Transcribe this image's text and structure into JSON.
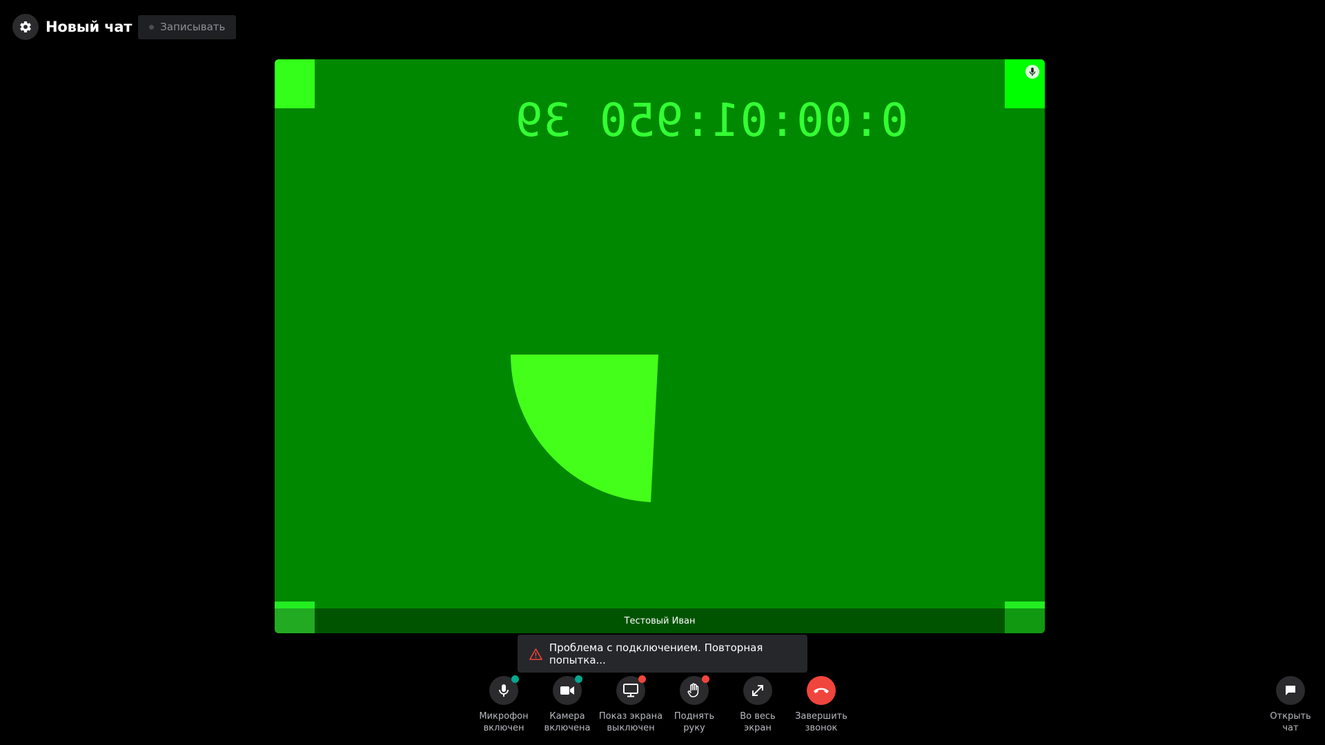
{
  "header": {
    "title": "Новый чат",
    "record_label": "Записывать"
  },
  "video": {
    "timecode": "0:00:01:950 39",
    "participant_name": "Тестовый Иван",
    "background_color": "#008800",
    "shape_color": "#44ff1a"
  },
  "toast": {
    "message": "Проблема с подключением. Повторная попытка..."
  },
  "controls": [
    {
      "id": "mic",
      "line1": "Микрофон",
      "line2": "включен",
      "dot": "#00a88f",
      "icon": "microphone-icon"
    },
    {
      "id": "camera",
      "line1": "Камера",
      "line2": "включена",
      "dot": "#00a88f",
      "icon": "camera-icon"
    },
    {
      "id": "screen",
      "line1": "Показ экрана",
      "line2": "выключен",
      "dot": "#f0453c",
      "icon": "monitor-icon"
    },
    {
      "id": "hand",
      "line1": "Поднять",
      "line2": "руку",
      "dot": "#f0453c",
      "icon": "hand-icon"
    },
    {
      "id": "fullscreen",
      "line1": "Во весь",
      "line2": "экран",
      "dot": null,
      "icon": "expand-icon"
    },
    {
      "id": "end",
      "line1": "Завершить",
      "line2": "звонок",
      "dot": null,
      "icon": "hang-up-icon"
    }
  ],
  "chat_toggle": {
    "line1": "Открыть",
    "line2": "чат",
    "icon": "chat-bubble-icon"
  }
}
